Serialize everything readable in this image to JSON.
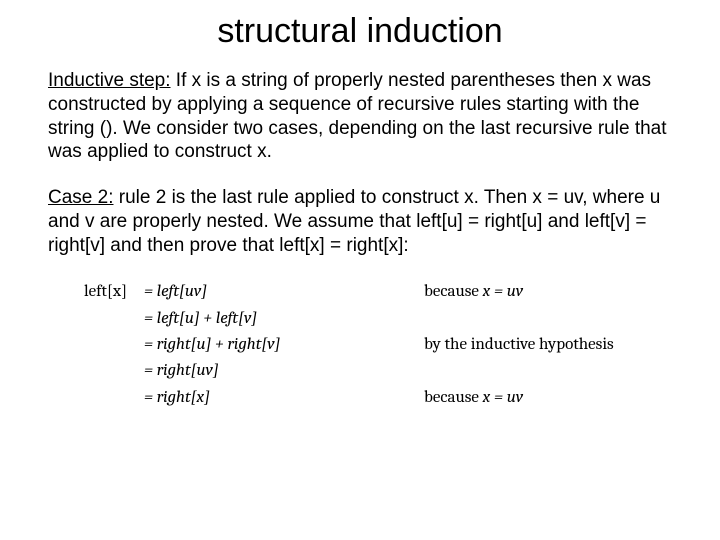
{
  "title": "structural induction",
  "inductive_label": "Inductive step:",
  "inductive_text": " If x is a string of properly nested parentheses then x was constructed by applying a sequence of recursive rules starting with the string (). We consider two cases, depending on the last recursive rule that was applied to construct x.",
  "case2_label": "Case 2:",
  "case2_text": " rule 2 is the last rule applied to construct x. Then x = uv, where u and v are properly nested. We assume that left[u] = right[u] and left[v] = right[v] and then prove that left[x] = right[x]:",
  "proof": {
    "r1_left": "left[x]",
    "r1_mid": "= left[uv]",
    "r1_right_a": "because ",
    "r1_right_b": "x = uv",
    "r2_mid": "= left[u] + left[v]",
    "r3_mid": "= right[u] + right[v]",
    "r3_right": "by the inductive hypothesis",
    "r4_mid": "= right[uv]",
    "r5_mid": "= right[x]",
    "r5_right_a": "because ",
    "r5_right_b": "x = uv"
  }
}
